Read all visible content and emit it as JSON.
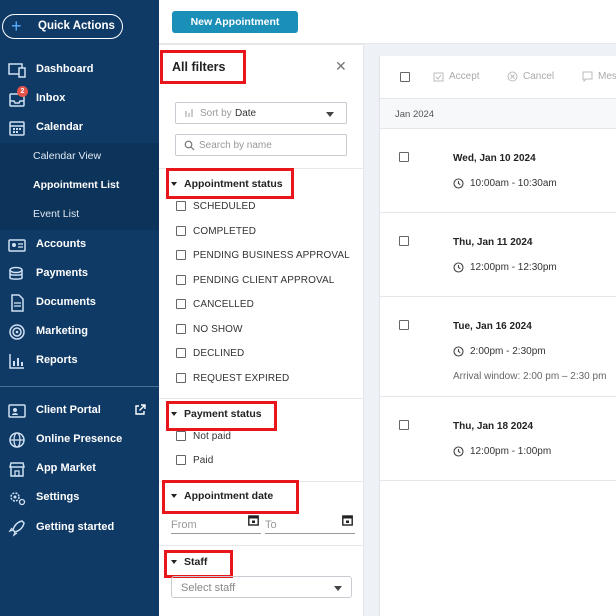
{
  "sidebar": {
    "quick_actions": "Quick Actions",
    "items": [
      {
        "label": "Dashboard",
        "icon": "dashboard-icon"
      },
      {
        "label": "Inbox",
        "icon": "inbox-icon",
        "badge": "2"
      },
      {
        "label": "Calendar",
        "icon": "calendar-icon"
      },
      {
        "label": "Accounts",
        "icon": "accounts-icon"
      },
      {
        "label": "Payments",
        "icon": "payments-icon"
      },
      {
        "label": "Documents",
        "icon": "documents-icon"
      },
      {
        "label": "Marketing",
        "icon": "marketing-icon"
      },
      {
        "label": "Reports",
        "icon": "reports-icon"
      },
      {
        "label": "Client Portal",
        "icon": "client-portal-icon"
      },
      {
        "label": "Online Presence",
        "icon": "globe-icon"
      },
      {
        "label": "App Market",
        "icon": "store-icon"
      },
      {
        "label": "Settings",
        "icon": "gear-icon"
      },
      {
        "label": "Getting started",
        "icon": "rocket-icon"
      }
    ],
    "calendar_sub": [
      {
        "label": "Calendar View",
        "active": false
      },
      {
        "label": "Appointment List",
        "active": true
      },
      {
        "label": "Event List",
        "active": false
      }
    ],
    "colors": {
      "bg": "#0f3a66",
      "accent": "#5ab0ff"
    }
  },
  "top_bar": {
    "new_appointment": "New Appointment",
    "button_color": "#1a8fb8"
  },
  "filters": {
    "title": "All filters",
    "sort_prefix": "Sort by",
    "sort_value": "Date",
    "search_placeholder": "Search by name",
    "appointment_status": {
      "title": "Appointment status",
      "options": [
        "SCHEDULED",
        "COMPLETED",
        "PENDING BUSINESS APPROVAL",
        "PENDING CLIENT APPROVAL",
        "CANCELLED",
        "NO SHOW",
        "DECLINED",
        "REQUEST EXPIRED"
      ]
    },
    "payment_status": {
      "title": "Payment status",
      "options": [
        "Not paid",
        "Paid"
      ]
    },
    "appointment_date": {
      "title": "Appointment date",
      "from_placeholder": "From",
      "to_placeholder": "To"
    },
    "staff": {
      "title": "Staff",
      "placeholder": "Select staff"
    },
    "highlight_color": "#e8161b"
  },
  "list": {
    "toolbar": {
      "accept": "Accept",
      "cancel": "Cancel",
      "message": "Mes"
    },
    "month": "Jan 2024",
    "appointments": [
      {
        "date": "Wed, Jan 10 2024",
        "time": "10:00am - 10:30am",
        "arrival": ""
      },
      {
        "date": "Thu, Jan 11 2024",
        "time": "12:00pm - 12:30pm",
        "arrival": ""
      },
      {
        "date": "Tue, Jan 16 2024",
        "time": "2:00pm - 2:30pm",
        "arrival": "Arrival window: 2:00 pm – 2:30 pm"
      },
      {
        "date": "Thu, Jan 18 2024",
        "time": "12:00pm - 1:00pm",
        "arrival": ""
      }
    ]
  }
}
